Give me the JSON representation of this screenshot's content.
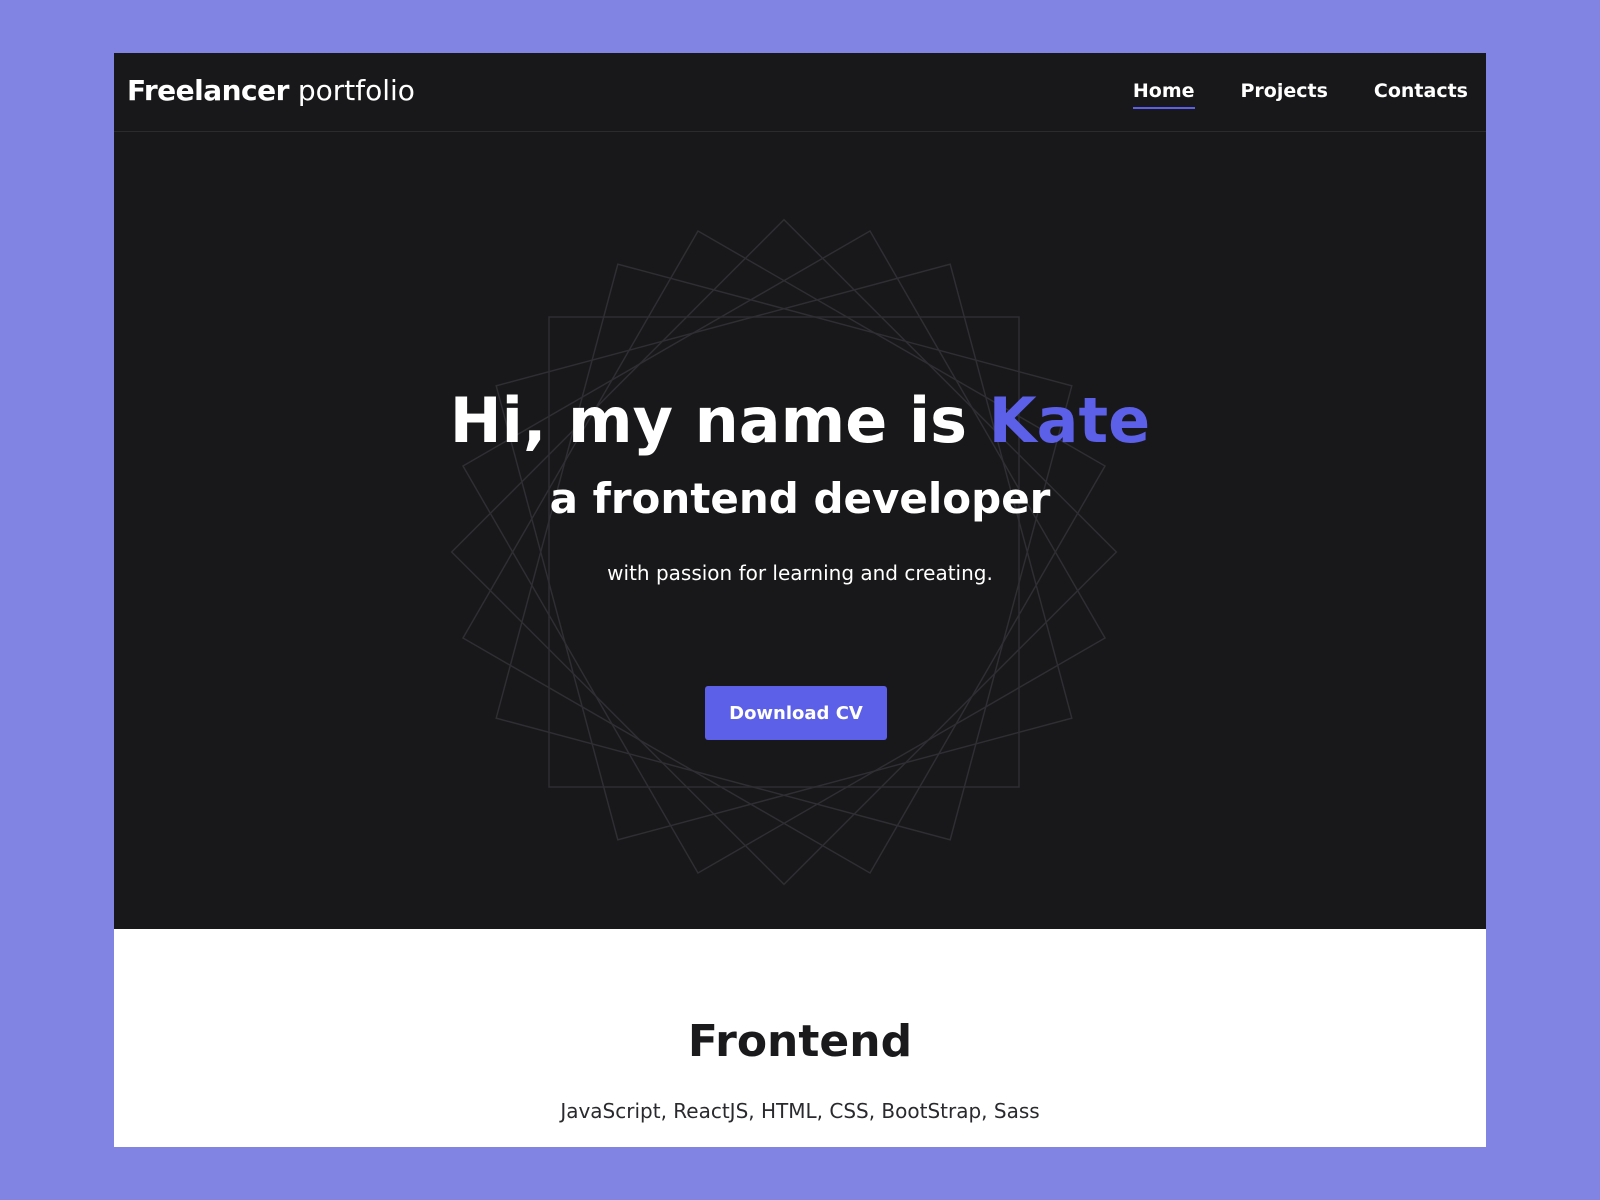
{
  "nav": {
    "brand_bold": "Freelancer",
    "brand_light": "portfolio",
    "links": [
      {
        "label": "Home",
        "active": true
      },
      {
        "label": "Projects",
        "active": false
      },
      {
        "label": "Contacts",
        "active": false
      }
    ]
  },
  "hero": {
    "title_prefix": "Hi, my name is ",
    "title_name": "Kate",
    "subtitle": "a frontend developer",
    "tagline": "with passion for learning and creating.",
    "cta_label": "Download CV"
  },
  "skills": {
    "title": "Frontend",
    "list": "JavaScript, ReactJS, HTML, CSS, BootStrap, Sass"
  },
  "colors": {
    "page_background": "#8284e4",
    "dark_background": "#18181a",
    "accent": "#5c5fe8",
    "text_light": "#ffffff",
    "text_dark": "#1a1a1c"
  },
  "icons": [
    "decorative-squares-pattern"
  ]
}
